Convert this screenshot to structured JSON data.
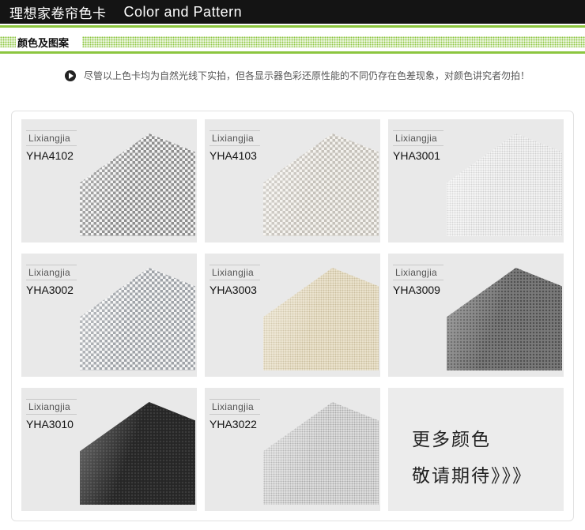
{
  "header": {
    "title_cn": "理想家卷帘色卡",
    "title_en": "Color and Pattern"
  },
  "section": {
    "label": "颜色及图案"
  },
  "notice": {
    "text": "尽管以上色卡均为自然光线下实拍，但各显示器色彩还原性能的不同仍存在色差现象，对颜色讲究者勿拍！"
  },
  "swatches": [
    {
      "brand": "Lixiangjia",
      "code": "YHA4102"
    },
    {
      "brand": "Lixiangjia",
      "code": "YHA4103"
    },
    {
      "brand": "Lixiangjia",
      "code": "YHA3001"
    },
    {
      "brand": "Lixiangjia",
      "code": "YHA3002"
    },
    {
      "brand": "Lixiangjia",
      "code": "YHA3003"
    },
    {
      "brand": "Lixiangjia",
      "code": "YHA3009"
    },
    {
      "brand": "Lixiangjia",
      "code": "YHA3010"
    },
    {
      "brand": "Lixiangjia",
      "code": "YHA3022"
    }
  ],
  "more": {
    "line1": "更多颜色",
    "line2": "敬请期待》》》"
  },
  "colors": {
    "header_bg": "#141414",
    "accent_green": "#8cc63f",
    "tile_bg": "#e9e9e9"
  },
  "icons": {
    "notice_bullet": "play-circle-icon"
  }
}
